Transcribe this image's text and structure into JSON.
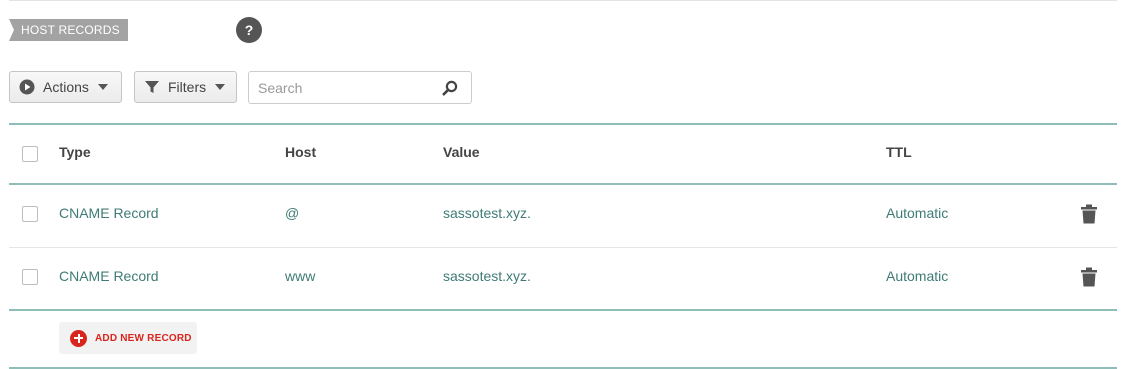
{
  "section": {
    "title": "HOST RECORDS",
    "help_label": "?"
  },
  "toolbar": {
    "actions_label": "Actions",
    "filters_label": "Filters",
    "search_placeholder": "Search",
    "search_value": ""
  },
  "table": {
    "columns": {
      "type": "Type",
      "host": "Host",
      "value": "Value",
      "ttl": "TTL"
    },
    "rows": [
      {
        "type": "CNAME Record",
        "host": "@",
        "value": "sassotest.xyz.",
        "ttl": "Automatic"
      },
      {
        "type": "CNAME Record",
        "host": "www",
        "value": "sassotest.xyz.",
        "ttl": "Automatic"
      }
    ]
  },
  "add_record_label": "ADD NEW RECORD",
  "icons": {
    "actions": "play-circle-icon",
    "filters": "funnel-icon",
    "search": "magnifier-icon",
    "delete": "trash-icon",
    "add": "plus-circle-icon"
  },
  "colors": {
    "accent_teal": "#3f7b75",
    "rule_teal": "#8fbdb8",
    "danger_red": "#d8261f",
    "tag_gray": "#a3a3a3"
  }
}
